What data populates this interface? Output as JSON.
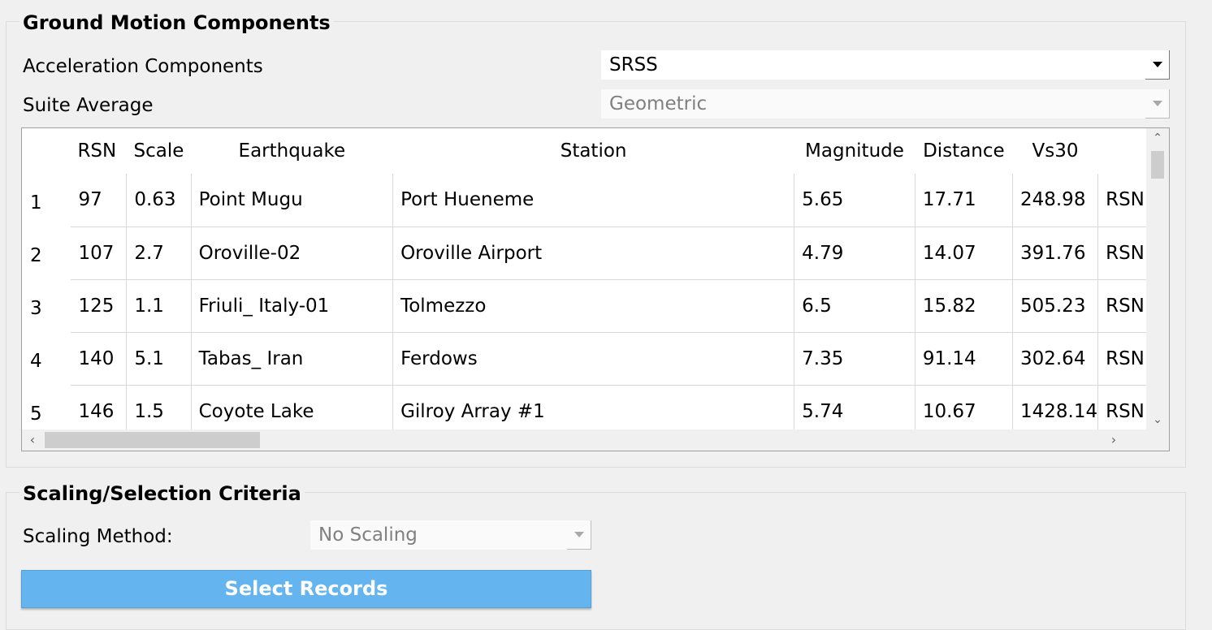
{
  "ground_motion": {
    "title": "Ground Motion Components",
    "accel_label": "Acceleration Components",
    "accel_value": "SRSS",
    "suite_label": "Suite Average",
    "suite_value": "Geometric"
  },
  "table": {
    "headers": [
      "RSN",
      "Scale",
      "Earthquake",
      "Station",
      "Magnitude",
      "Distance",
      "Vs30",
      ""
    ],
    "rows": [
      {
        "index": "1",
        "cells": [
          "97",
          "0.63",
          "Point Mugu",
          "Port Hueneme",
          "5.65",
          "17.71",
          "248.98",
          "RSN"
        ]
      },
      {
        "index": "2",
        "cells": [
          "107",
          "2.7",
          "Oroville-02",
          "Oroville Airport",
          "4.79",
          "14.07",
          "391.76",
          "RSN"
        ]
      },
      {
        "index": "3",
        "cells": [
          "125",
          "1.1",
          "Friuli_ Italy-01",
          "Tolmezzo",
          "6.5",
          "15.82",
          "505.23",
          "RSN"
        ]
      },
      {
        "index": "4",
        "cells": [
          "140",
          "5.1",
          "Tabas_ Iran",
          "Ferdows",
          "7.35",
          "91.14",
          "302.64",
          "RSN"
        ]
      },
      {
        "index": "5",
        "cells": [
          "146",
          "1.5",
          "Coyote Lake",
          "Gilroy Array #1",
          "5.74",
          "10.67",
          "1428.14",
          "RSN"
        ]
      },
      {
        "index": "",
        "cells": [
          "",
          "",
          "",
          "",
          "",
          "",
          "",
          ""
        ]
      }
    ]
  },
  "scaling": {
    "title": "Scaling/Selection Criteria",
    "method_label": "Scaling Method:",
    "method_value": "No Scaling",
    "select_button": "Select Records"
  }
}
